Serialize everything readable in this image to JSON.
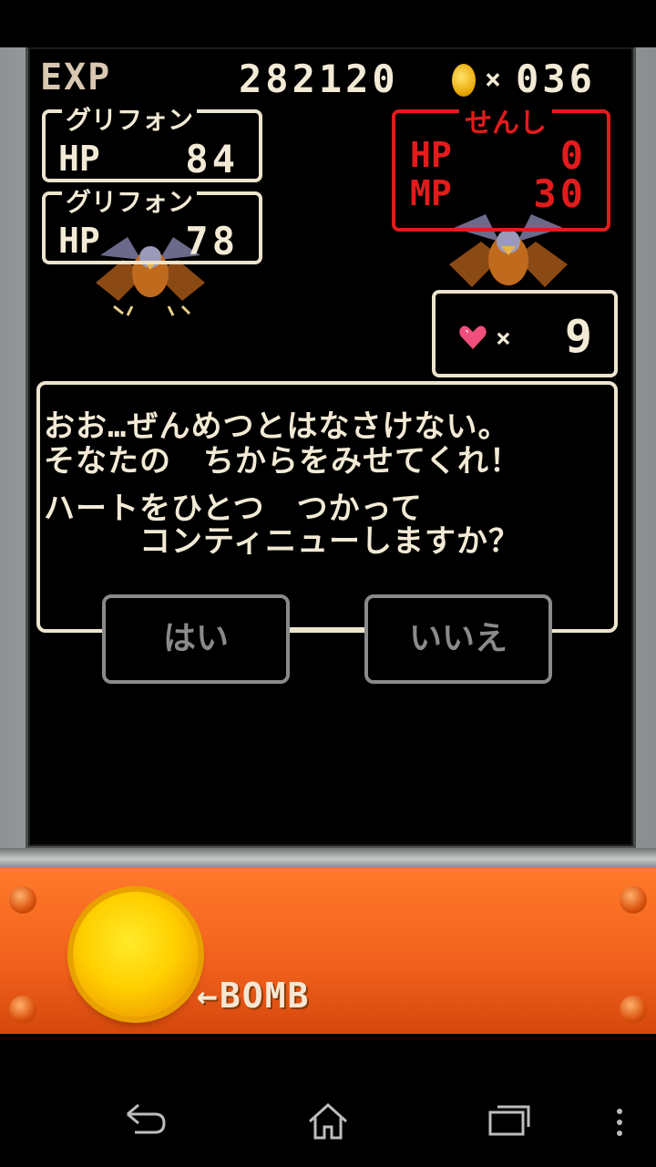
{
  "header": {
    "exp_label": "EXP",
    "exp_value": "282120",
    "coin_x": "×",
    "coin_count": "036"
  },
  "enemies": [
    {
      "name": "グリフォン",
      "hp_label": "HP",
      "hp": "84"
    },
    {
      "name": "グリフォン",
      "hp_label": "HP",
      "hp": "78"
    }
  ],
  "player": {
    "name": "せんし",
    "hp_label": "HP",
    "hp": "0",
    "mp_label": "MP",
    "mp": "30"
  },
  "hearts": {
    "x": "×",
    "count": "9"
  },
  "dialog": {
    "lines": [
      "おお…ぜんめつとはなさけない。",
      "そなたの　ちからをみせてくれ！",
      "ハートをひとつ　つかって",
      "　　　コンティニューしますか？"
    ],
    "yes": "はい",
    "no": "いいえ"
  },
  "controls": {
    "bomb_label": "←BOMB"
  },
  "icons": {
    "coin": "coin-icon",
    "heart": "heart-icon",
    "back": "back-icon",
    "home": "home-icon",
    "recent": "recent-apps-icon",
    "menu": "menu-icon"
  },
  "colors": {
    "text": "#f2ead5",
    "player_box": "#e31b1b",
    "button_disabled": "#8a8a8a",
    "control_bar": "#f0601c",
    "bomb": "#ffd000"
  }
}
